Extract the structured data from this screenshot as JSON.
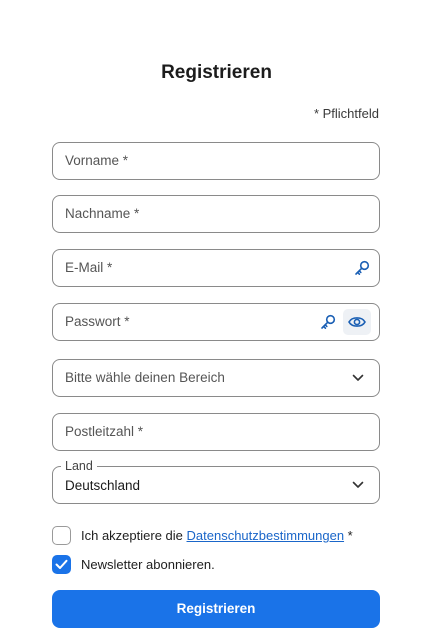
{
  "form": {
    "title": "Registrieren",
    "required_note": "* Pflichtfeld",
    "fields": {
      "vorname": {
        "placeholder": "Vorname *"
      },
      "nachname": {
        "placeholder": "Nachname *"
      },
      "email": {
        "placeholder": "E-Mail *",
        "icon": "key-icon"
      },
      "passwort": {
        "placeholder": "Passwort *",
        "icons": [
          "key-icon",
          "eye-icon"
        ]
      },
      "bereich": {
        "placeholder": "Bitte wähle deinen Bereich",
        "icon": "chevron-down-icon"
      },
      "postleitzahl": {
        "placeholder": "Postleitzahl *"
      },
      "land": {
        "label": "Land",
        "value": "Deutschland",
        "icon": "chevron-down-icon"
      }
    },
    "consent": {
      "privacy": {
        "checked": false,
        "text_before": "Ich akzeptiere die ",
        "link_text": "Datenschutzbestimmungen",
        "text_after": " *"
      },
      "newsletter": {
        "checked": true,
        "text": "Newsletter abonnieren."
      }
    },
    "submit_label": "Registrieren"
  },
  "colors": {
    "accent": "#1a73e8",
    "link": "#1a66c9",
    "border": "#8a8a8a",
    "icon_blue": "#1a5fb4"
  }
}
